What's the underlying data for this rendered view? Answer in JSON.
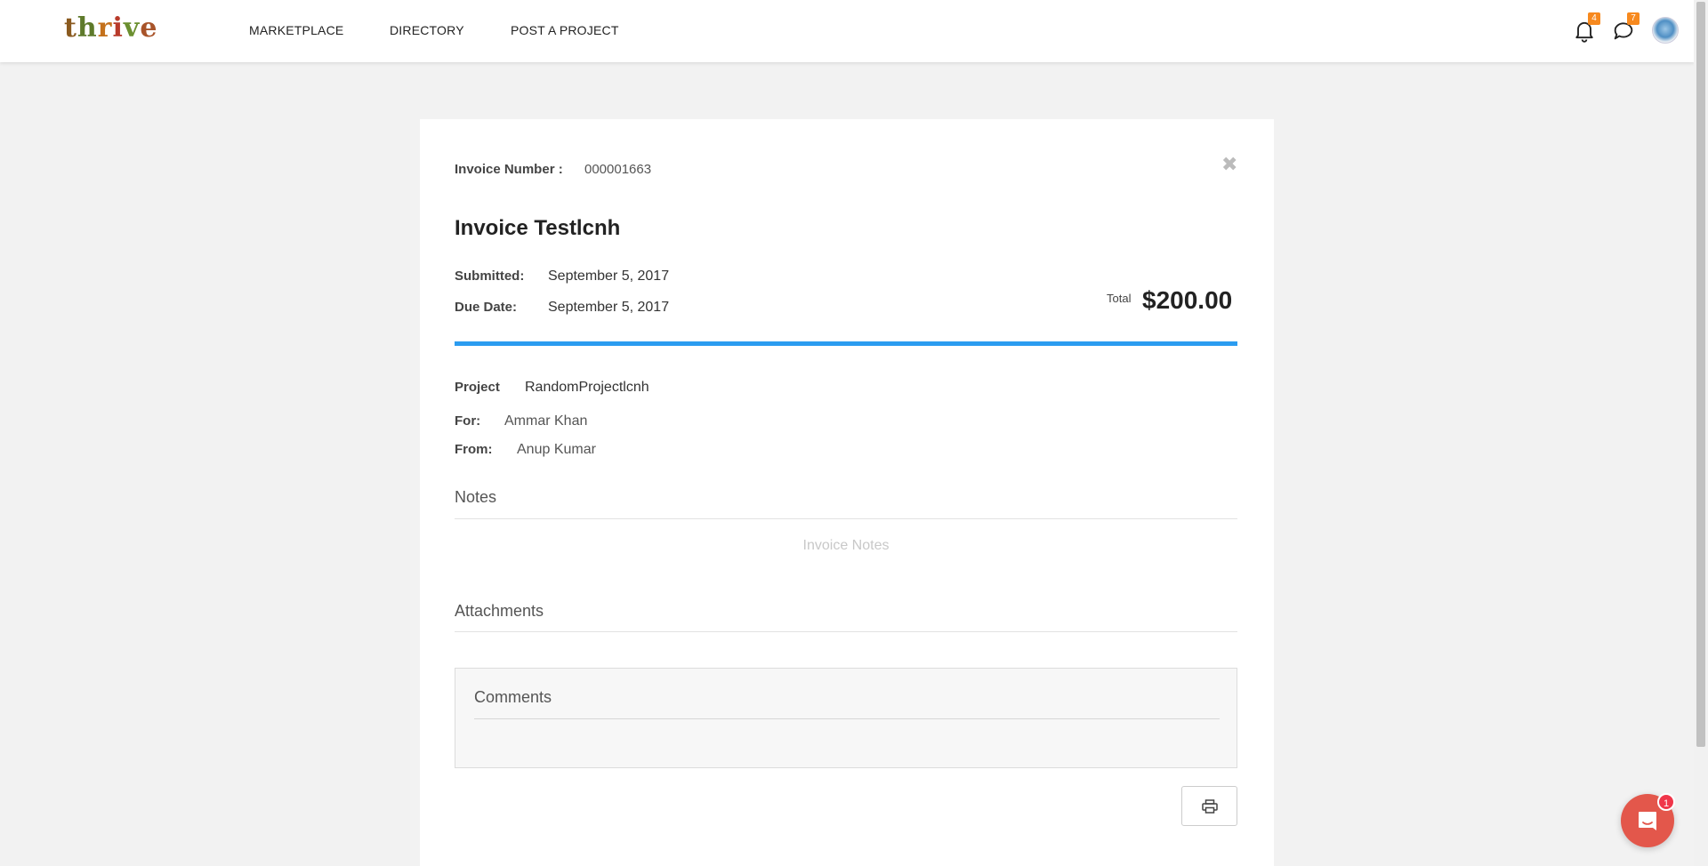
{
  "header": {
    "logo_text": "thrive",
    "nav": [
      {
        "label": "MARKETPLACE"
      },
      {
        "label": "DIRECTORY"
      },
      {
        "label": "POST A PROJECT"
      }
    ],
    "notifications_count": "4",
    "messages_count": "7",
    "icons": [
      "bell-icon",
      "chat-icon",
      "avatar"
    ]
  },
  "invoice": {
    "number_label": "Invoice Number :",
    "number_value": "000001663",
    "title": "Invoice Testlcnh",
    "submitted_label": "Submitted:",
    "submitted_value": "September 5, 2017",
    "due_label": "Due Date:",
    "due_value": "September 5, 2017",
    "total_label": "Total",
    "total_value": "$200.00",
    "progress_percent": 100,
    "project_label": "Project",
    "project_value": "RandomProjectlcnh",
    "for_label": "For:",
    "for_value": "Ammar Khan",
    "from_label": "From:",
    "from_value": "Anup Kumar",
    "notes_heading": "Notes",
    "notes_placeholder": "Invoice Notes",
    "attachments_heading": "Attachments",
    "comments_heading": "Comments"
  },
  "launcher": {
    "badge_count": "1"
  },
  "colors": {
    "accent": "#2b9cf0",
    "badge": "#f7891e",
    "launcher": "#e3574b"
  }
}
